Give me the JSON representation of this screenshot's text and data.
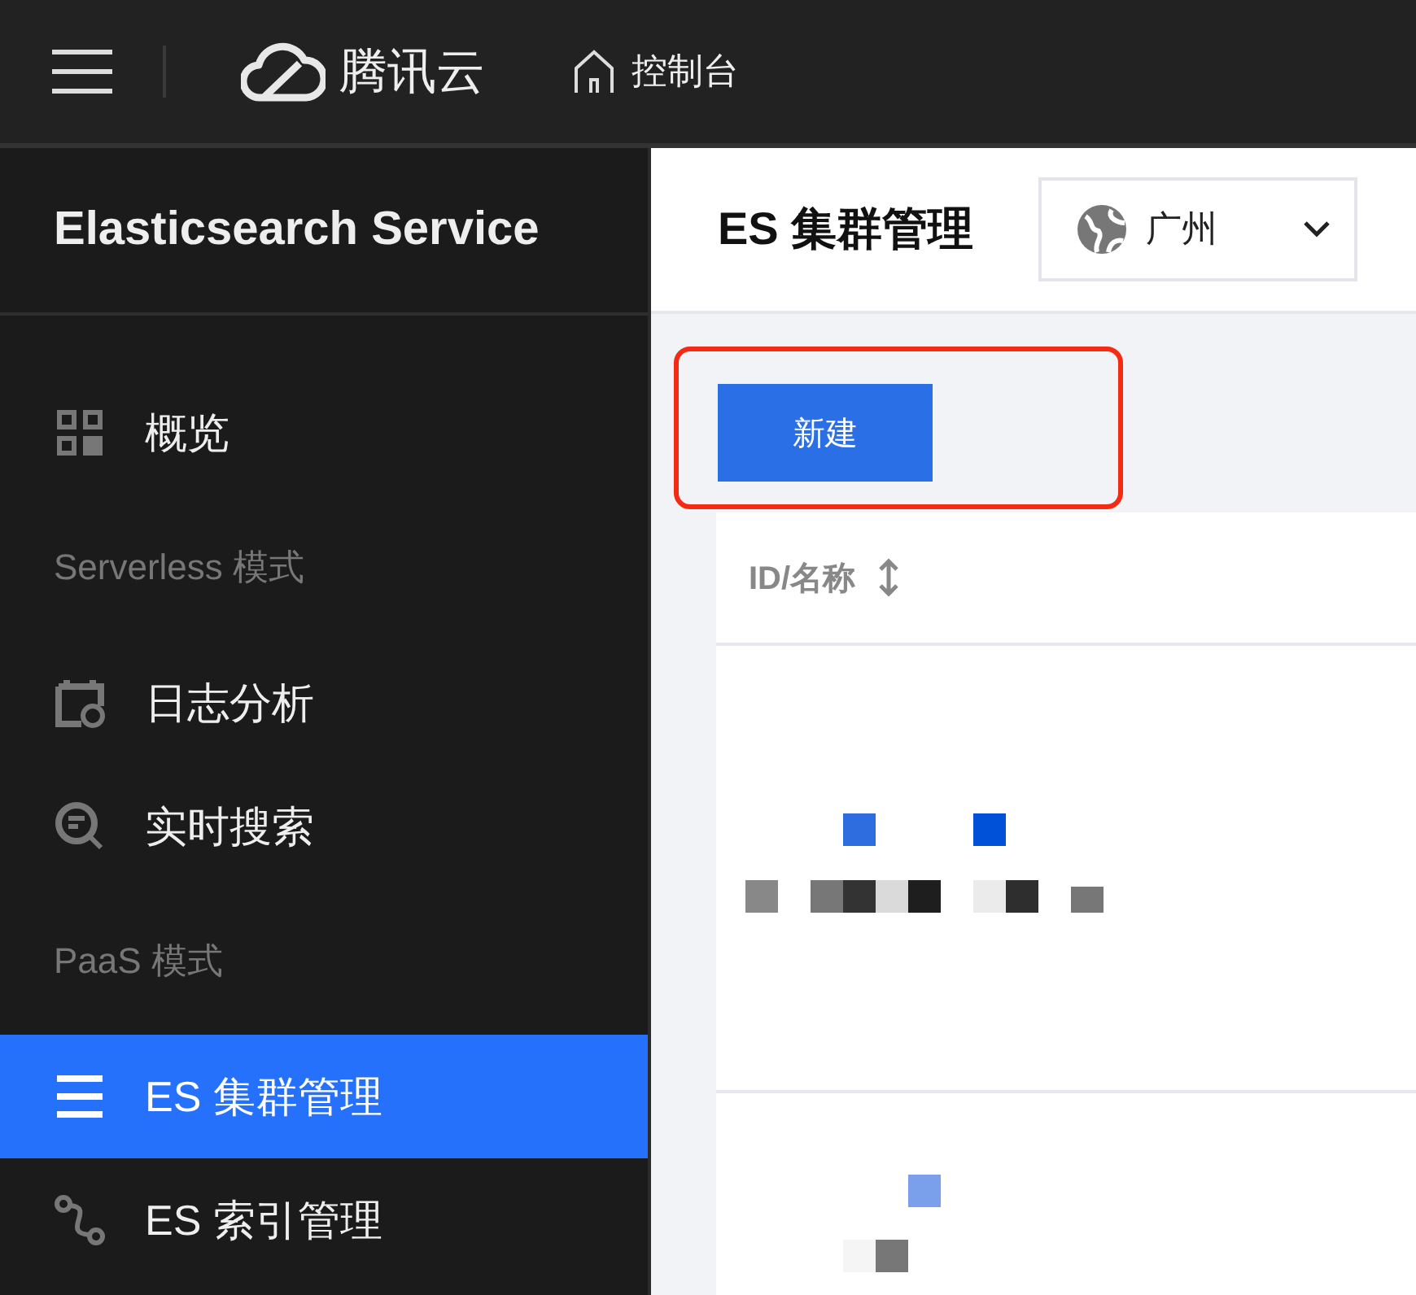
{
  "topbar": {
    "brand": "腾讯云",
    "console_link": "控制台"
  },
  "sidebar": {
    "title": "Elasticsearch Service",
    "items": [
      {
        "kind": "item",
        "label": "概览",
        "selected": false
      },
      {
        "kind": "group",
        "label": "Serverless 模式"
      },
      {
        "kind": "item",
        "label": "日志分析",
        "selected": false
      },
      {
        "kind": "item",
        "label": "实时搜索",
        "selected": false
      },
      {
        "kind": "group",
        "label": "PaaS 模式"
      },
      {
        "kind": "item",
        "label": "ES 集群管理",
        "selected": true
      },
      {
        "kind": "item",
        "label": "ES 索引管理",
        "selected": false
      }
    ]
  },
  "page": {
    "title": "ES 集群管理",
    "region": "广州"
  },
  "new_button": {
    "label": "新建",
    "highlighted": true
  },
  "table": {
    "columns": [
      {
        "label": "ID/名称",
        "sortable": true
      }
    ],
    "rows": [
      {
        "kind": "redacted"
      },
      {
        "kind": "redacted"
      }
    ]
  }
}
